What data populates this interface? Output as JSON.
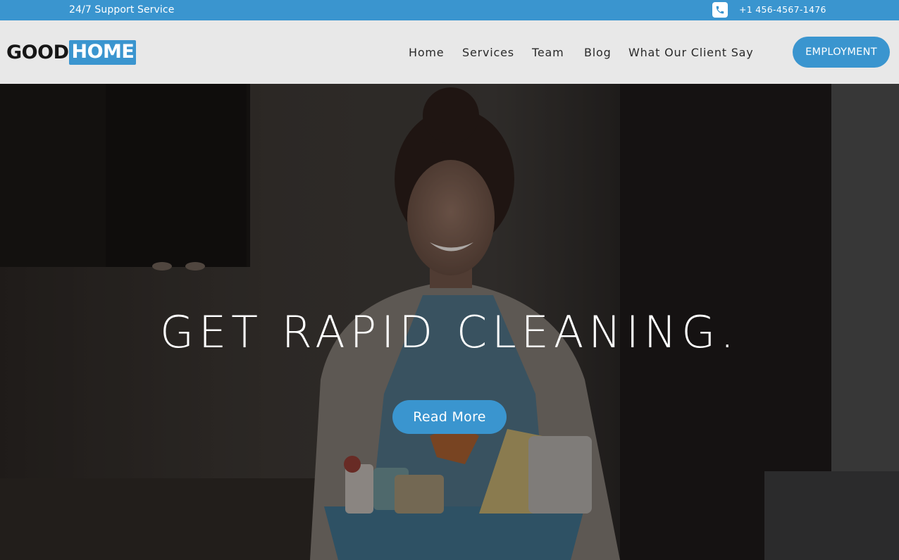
{
  "topbar": {
    "support_text": "24/7 Support Service",
    "phone_icon": "phone-icon",
    "phone_number": "+1 456-4567-1476"
  },
  "header": {
    "logo": {
      "part1": "GOOD",
      "part2": "HOME"
    },
    "nav": {
      "home": "Home",
      "services": "Services",
      "team": "Team",
      "blog": "Blog",
      "clients": "What Our Client Say"
    },
    "cta_label": "EMPLOYMENT"
  },
  "hero": {
    "title": "GET RAPID CLEANING.",
    "button_label": "Read More"
  },
  "colors": {
    "accent": "#3a95cf",
    "header_bg": "#e8e8e8",
    "hero_overlay": "#1f1e1d"
  }
}
